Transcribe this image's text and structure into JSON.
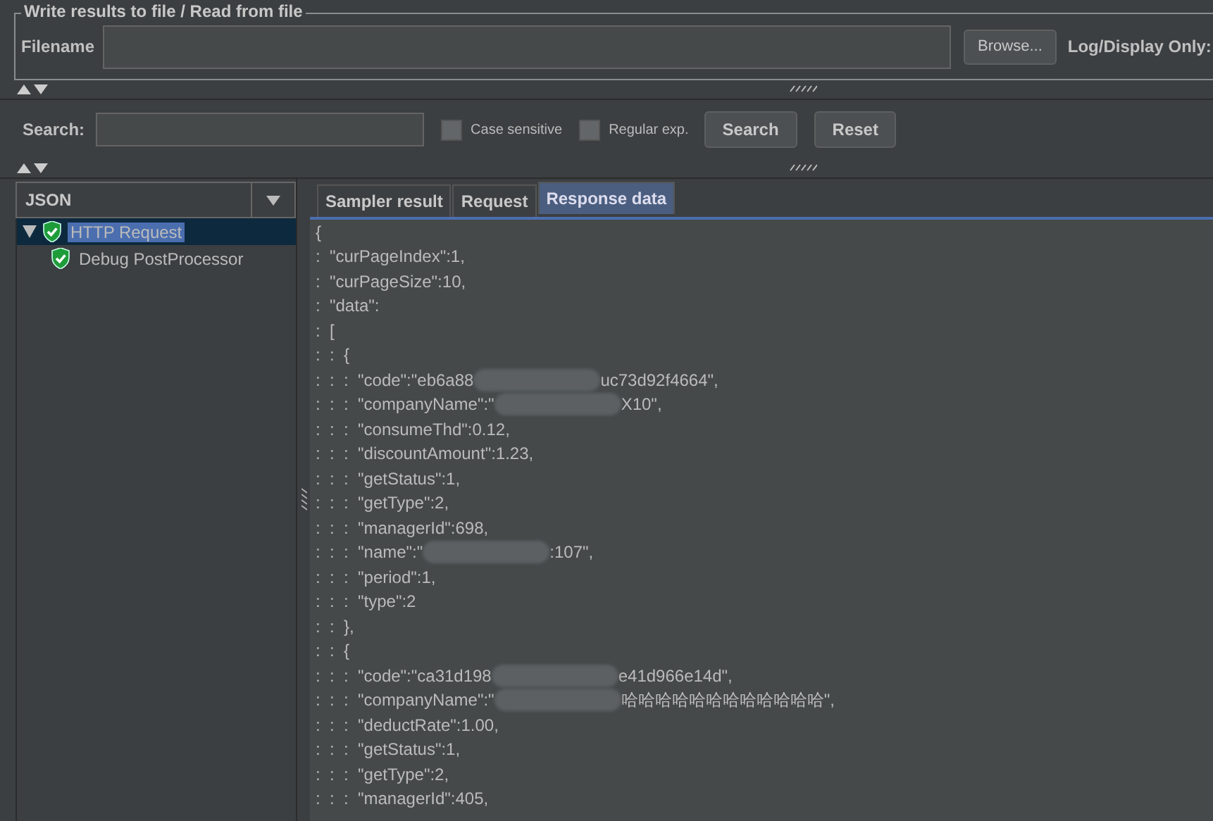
{
  "file_panel": {
    "title": "Write results to file / Read from file",
    "filename_label": "Filename",
    "browse_button": "Browse...",
    "log_label": "Log/Display Only:"
  },
  "search": {
    "label": "Search:",
    "options": [
      {
        "label": "Case sensitive",
        "checked": false
      },
      {
        "label": "Regular exp.",
        "checked": false
      }
    ],
    "buttons": [
      "Search",
      "Reset"
    ]
  },
  "renderer": {
    "value": "JSON"
  },
  "tree": [
    {
      "label": "HTTP Request",
      "expanded": true,
      "selected": true,
      "children": [
        {
          "label": "Debug PostProcessor",
          "selected": false
        }
      ]
    }
  ],
  "tabs": [
    {
      "label": "Sampler result",
      "selected": false
    },
    {
      "label": "Request",
      "selected": false
    },
    {
      "label": "Response data",
      "selected": true
    }
  ],
  "response_lines": [
    {
      "text": "{"
    },
    {
      "text": ":  \"curPageIndex\":1,"
    },
    {
      "text": ":  \"curPageSize\":10,"
    },
    {
      "text": ":  \"data\":"
    },
    {
      "text": ":  ["
    },
    {
      "text": ":  :  {"
    },
    {
      "text": ":  :  :  \"code\":\"eb6a88",
      "after": "uc73d92f4664\","
    },
    {
      "text": ":  :  :  \"companyName\":\"",
      "after": "X10\","
    },
    {
      "text": ":  :  :  \"consumeThd\":0.12,"
    },
    {
      "text": ":  :  :  \"discountAmount\":1.23,"
    },
    {
      "text": ":  :  :  \"getStatus\":1,"
    },
    {
      "text": ":  :  :  \"getType\":2,"
    },
    {
      "text": ":  :  :  \"managerId\":698,"
    },
    {
      "text": ":  :  :  \"name\":\"",
      "after": ":107\","
    },
    {
      "text": ":  :  :  \"period\":1,"
    },
    {
      "text": ":  :  :  \"type\":2"
    },
    {
      "text": ":  :  },"
    },
    {
      "text": ":  :  {"
    },
    {
      "text": ":  :  :  \"code\":\"ca31d198",
      "after": "e41d966e14d\","
    },
    {
      "text": ":  :  :  \"companyName\":\"",
      "after": "哈哈哈哈哈哈哈哈哈哈哈哈\","
    },
    {
      "text": ":  :  :  \"deductRate\":1.00,"
    },
    {
      "text": ":  :  :  \"getStatus\":1,"
    },
    {
      "text": ":  :  :  \"getType\":2,"
    },
    {
      "text": ":  :  :  \"managerId\":405,"
    }
  ]
}
